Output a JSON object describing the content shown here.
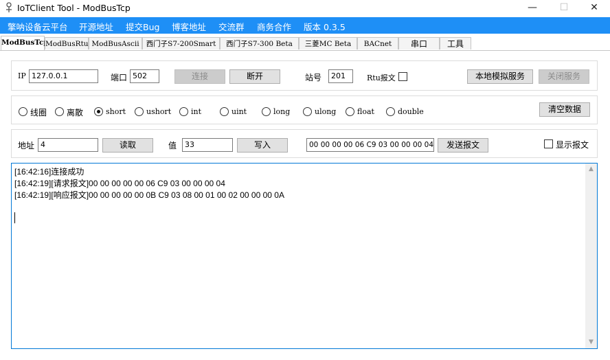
{
  "window": {
    "title": "IoTClient Tool - ModBusTcp",
    "minimize": "—",
    "maximize": "☐",
    "close": "✕"
  },
  "menu": [
    "擎呐设备云平台",
    "开源地址",
    "提交Bug",
    "博客地址",
    "交流群",
    "商务合作",
    "版本 0.3.5"
  ],
  "tabs": [
    "ModBusTcp",
    "ModBusRtu",
    "ModBusAscii",
    "西门子S7-200Smart",
    "西门子S7-300 Beta",
    "三菱MC Beta",
    "BACnet",
    "串口",
    "工具"
  ],
  "active_tab": "ModBusTcp",
  "connection": {
    "ip_label": "IP",
    "ip_value": "127.0.0.1",
    "port_label": "端口",
    "port_value": "502",
    "connect_button": "连接",
    "disconnect_button": "断开",
    "station_label": "站号",
    "station_value": "201",
    "rtu_label": "Rtu报文",
    "local_sim_button": "本地模拟服务",
    "close_service_button": "关闭服务"
  },
  "types": {
    "options": [
      "线圈",
      "离散",
      "short",
      "ushort",
      "int",
      "uint",
      "long",
      "ulong",
      "float",
      "double"
    ],
    "selected": "short",
    "clear_button": "清空数据"
  },
  "readwrite": {
    "address_label": "地址",
    "address_value": "4",
    "read_button": "读取",
    "value_label": "值",
    "value_value": "33",
    "write_button": "写入",
    "packet_value": "00 00 00 00 06 C9 03 00 00 00 04",
    "send_button": "发送报文",
    "show_packet_label": "显示报文"
  },
  "log": [
    "[16:42:16]连接成功",
    "[16:42:19][请求报文]00 00 00 00 00 06 C9 03 00 00 00 04",
    "[16:42:19][响应报文]00 00 00 00 00 0B C9 03 08 00 01 00 02 00 00 00 0A"
  ]
}
